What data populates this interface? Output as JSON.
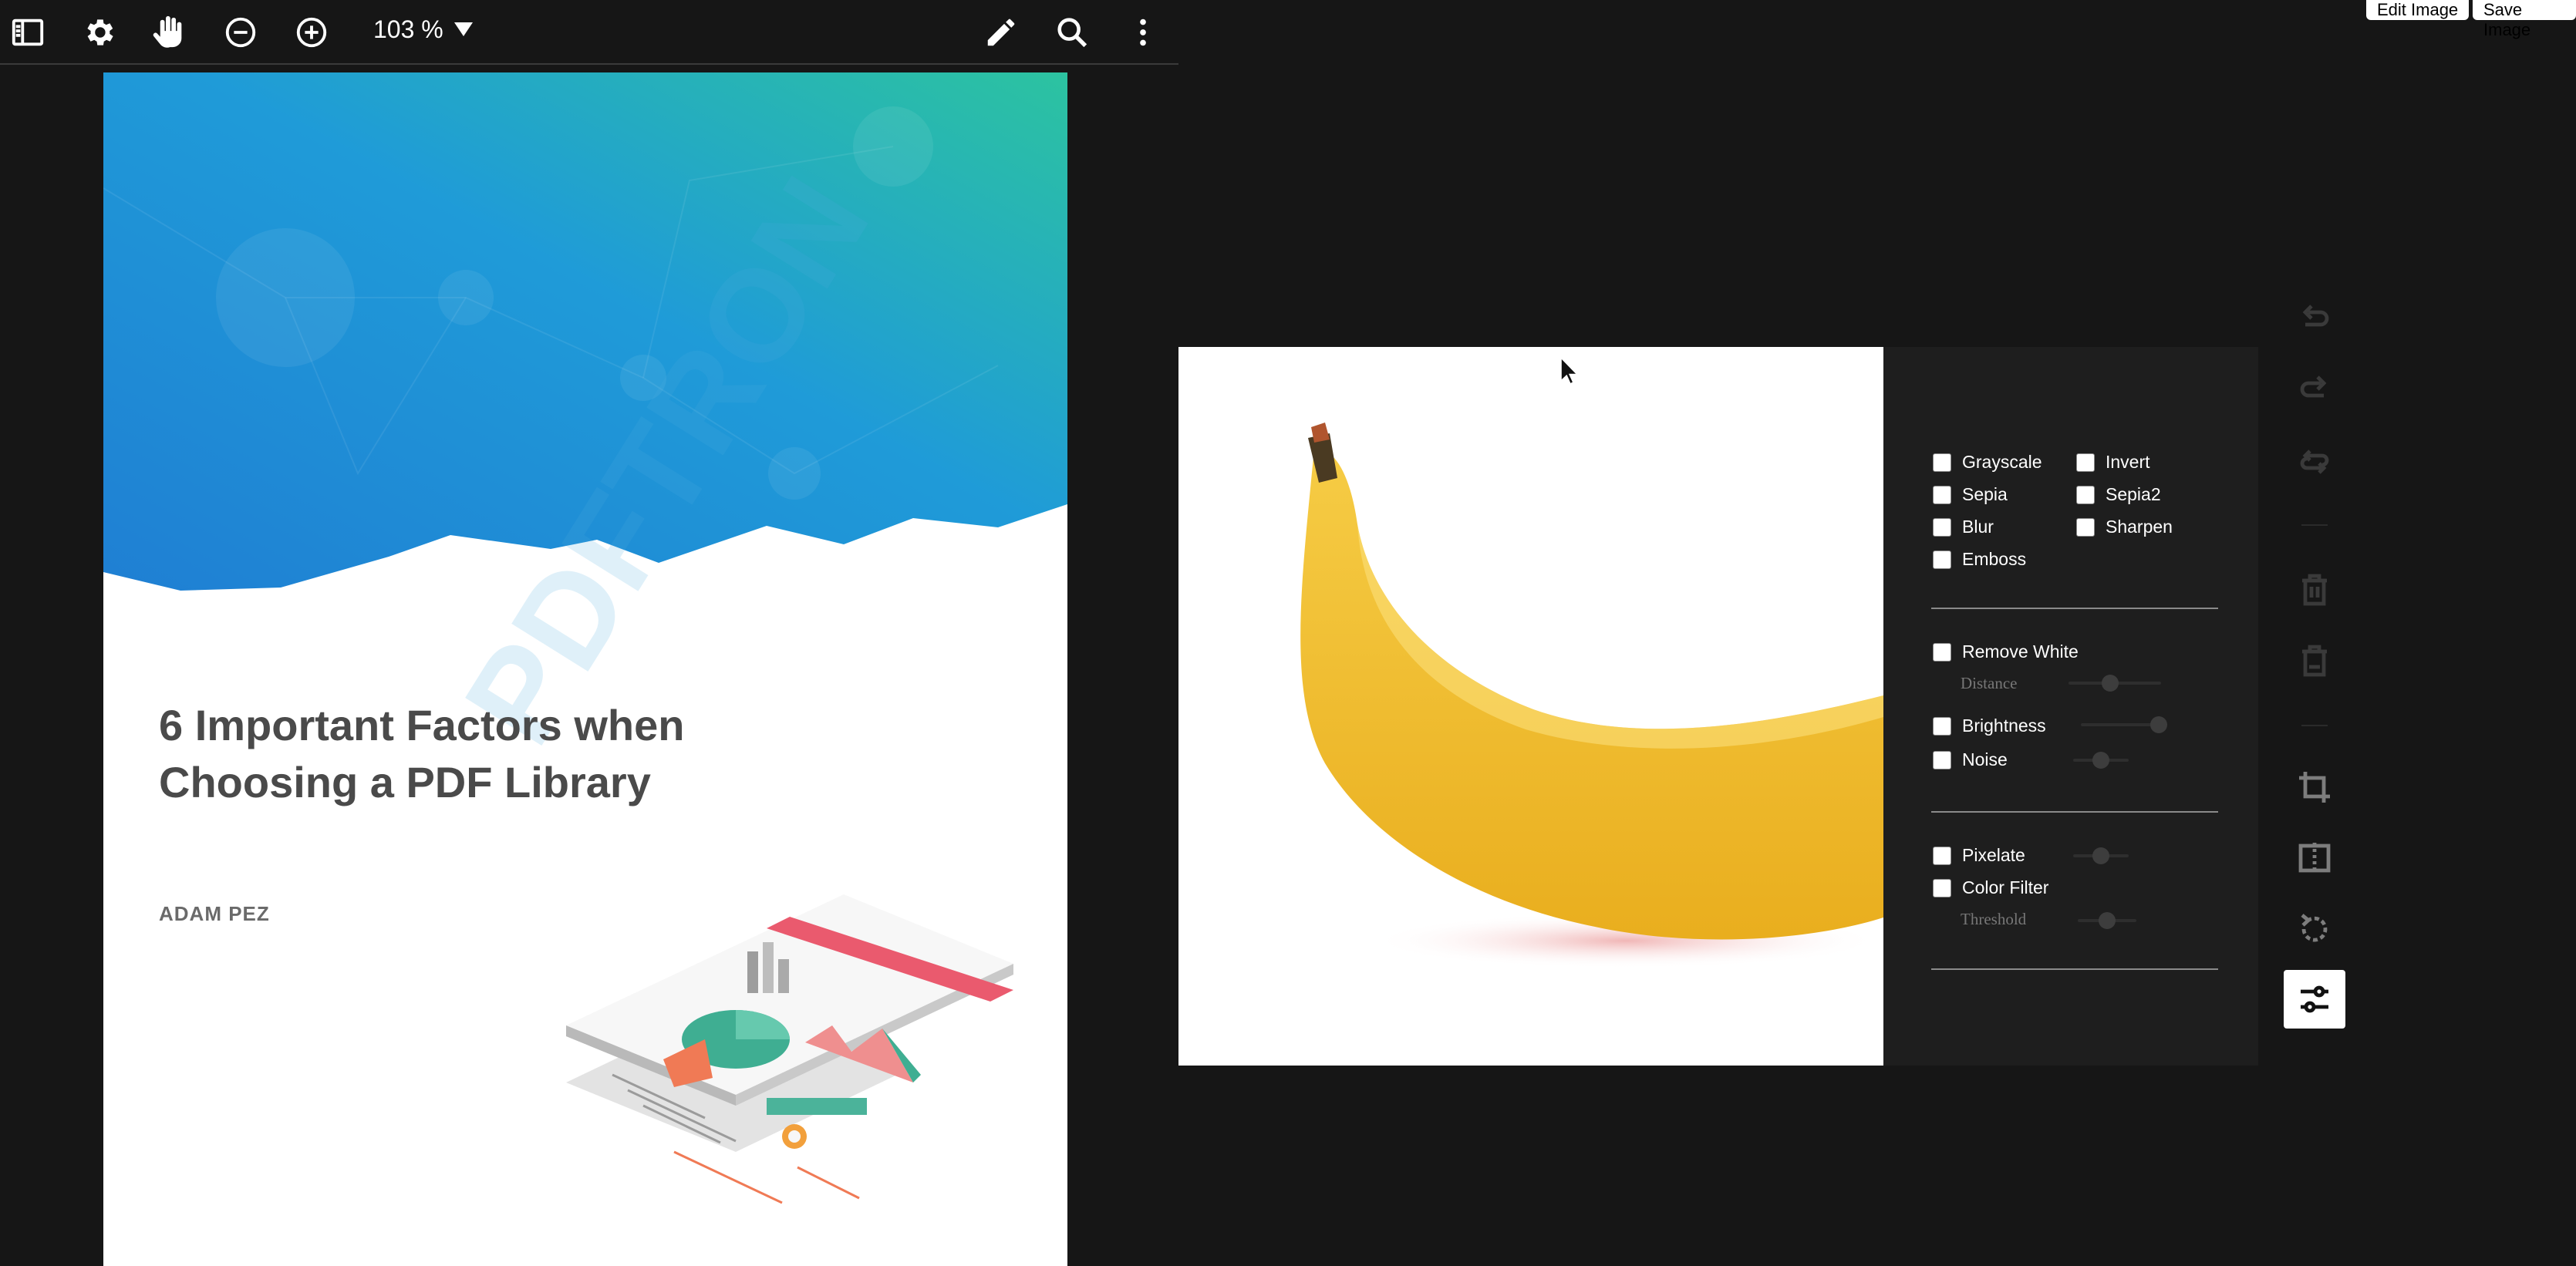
{
  "toolbar": {
    "zoom_label": "103 %",
    "icons": [
      "sidebar-icon",
      "gear-icon",
      "hand-icon",
      "zoom-out-icon",
      "zoom-in-icon",
      "pencil-icon",
      "search-icon",
      "more-icon"
    ]
  },
  "top_buttons": {
    "edit": "Edit Image",
    "save": "Save Image"
  },
  "document": {
    "title_line1": "6 Important Factors when",
    "title_line2": "Choosing a PDF Library",
    "author": "ADAM PEZ",
    "watermark": "PDFTRON"
  },
  "filters": {
    "grayscale": "Grayscale",
    "invert": "Invert",
    "sepia": "Sepia",
    "sepia2": "Sepia2",
    "blur": "Blur",
    "sharpen": "Sharpen",
    "emboss": "Emboss",
    "remove_white": "Remove White",
    "distance": "Distance",
    "brightness": "Brightness",
    "noise": "Noise",
    "pixelate": "Pixelate",
    "color_filter": "Color Filter",
    "threshold": "Threshold"
  },
  "slider_levels": {
    "distance": 0.45,
    "brightness": 0.9,
    "noise": 0.5,
    "pixelate": 0.5,
    "threshold": 0.5
  },
  "side_tools": [
    "undo-icon",
    "redo-icon",
    "reset-icon",
    "delete-icon",
    "delete-all-icon",
    "crop-icon",
    "flip-icon",
    "rotate-icon",
    "filters-icon"
  ],
  "colors": {
    "background": "#161616",
    "panel": "#1e1e1e",
    "cover_gradient_start": "#1f8ad6",
    "cover_gradient_end": "#2cbfa0",
    "banana": "#f2bf2e"
  }
}
